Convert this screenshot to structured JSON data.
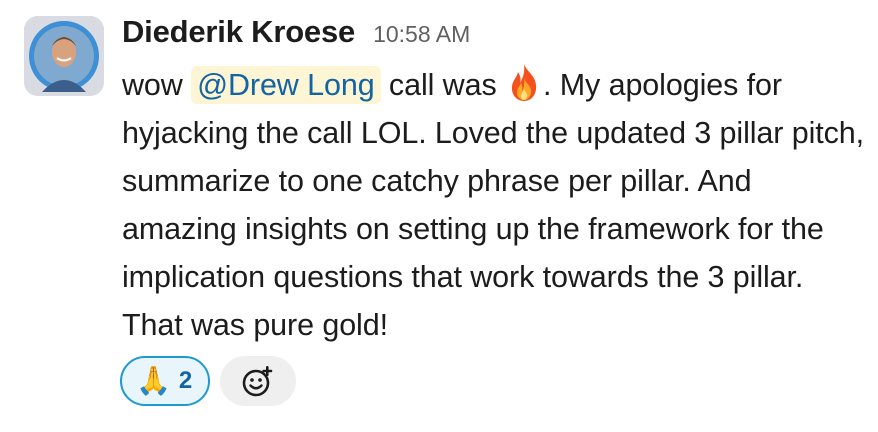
{
  "message": {
    "author": "Diederik Kroese",
    "timestamp": "10:58 AM",
    "text_before_mention": "wow ",
    "mention": "@Drew Long",
    "text_after_mention": " call was ",
    "emoji_inline": "fire",
    "text_after_emoji": ". My apologies for hyjacking the call LOL. Loved the updated 3 pillar pitch, summarize to one catchy phrase per pillar. And amazing insights on setting up the framework for the implication questions that work towards the 3 pillar. That was pure gold!"
  },
  "reactions": [
    {
      "emoji": "🙏",
      "count": "2",
      "active": true
    }
  ],
  "add_reaction_icon": "add-reaction-icon",
  "colors": {
    "mention_bg": "#fdf5d4",
    "mention_text": "#1264a3",
    "reaction_border": "#1d9bd1",
    "reaction_bg": "#e8f5fa"
  }
}
